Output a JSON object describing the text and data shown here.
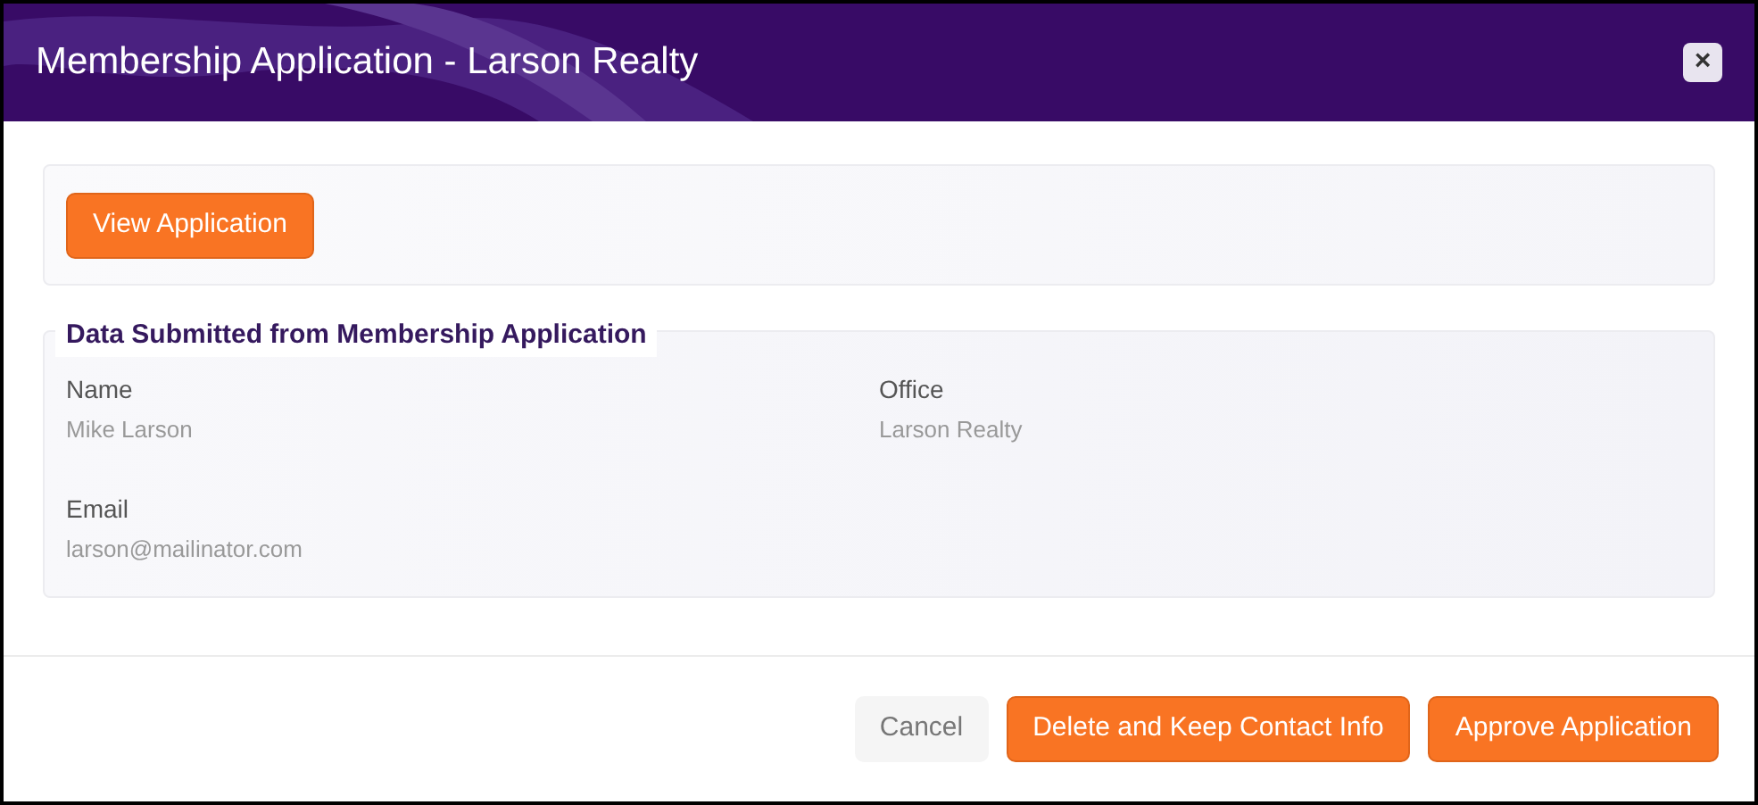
{
  "dialog": {
    "title": "Membership Application - Larson Realty",
    "close": "×"
  },
  "view_button": "View Application",
  "section": {
    "legend": "Data Submitted from Membership Application",
    "fields": [
      {
        "label": "Name",
        "value": "Mike Larson"
      },
      {
        "label": "Office",
        "value": "Larson Realty"
      },
      {
        "label": "Email",
        "value": "larson@mailinator.com"
      }
    ]
  },
  "buttons": [
    {
      "label": "Cancel",
      "kind": "secondary"
    },
    {
      "label": "Delete and Keep Contact Info",
      "kind": "primary"
    },
    {
      "label": "Approve Application",
      "kind": "primary"
    }
  ]
}
